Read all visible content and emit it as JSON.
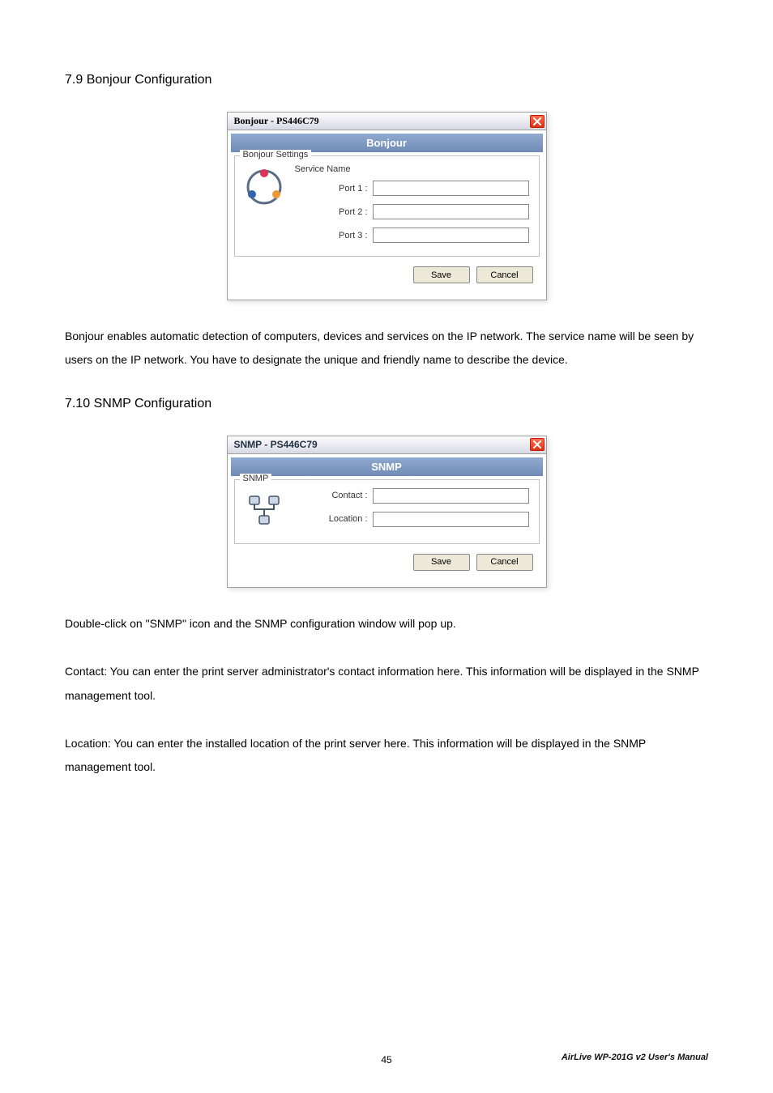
{
  "sections": {
    "bonjour": {
      "heading": "7.9 Bonjour Configuration",
      "dialog": {
        "title": "Bonjour - PS446C79",
        "band": "Bonjour",
        "group_legend": "Bonjour Settings",
        "service_name_header": "Service Name",
        "ports": {
          "p1": {
            "label": "Port 1 :",
            "value": ""
          },
          "p2": {
            "label": "Port 2 :",
            "value": ""
          },
          "p3": {
            "label": "Port 3 :",
            "value": ""
          }
        },
        "buttons": {
          "save": "Save",
          "cancel": "Cancel"
        }
      },
      "body_text": "Bonjour enables automatic detection of computers, devices and services on the IP network. The service name will be seen by users on the IP network. You have to designate the unique and friendly name to describe the device."
    },
    "snmp": {
      "heading": "7.10 SNMP Configuration",
      "dialog": {
        "title": "SNMP - PS446C79",
        "band": "SNMP",
        "group_legend": "SNMP",
        "fields": {
          "contact": {
            "label": "Contact :",
            "value": ""
          },
          "location": {
            "label": "Location :",
            "value": ""
          }
        },
        "buttons": {
          "save": "Save",
          "cancel": "Cancel"
        }
      },
      "body_paragraphs": {
        "p1": "Double-click on \"SNMP\" icon and the SNMP configuration window will pop up.",
        "p2": "Contact: You can enter the print server administrator's contact information here. This information will be displayed in the SNMP management tool.",
        "p3": "Location: You can enter the installed location of the print server here. This information will be displayed in the SNMP management tool."
      }
    }
  },
  "footer": {
    "page_number": "45",
    "brand": "AirLive WP-201G v2 User's Manual"
  }
}
